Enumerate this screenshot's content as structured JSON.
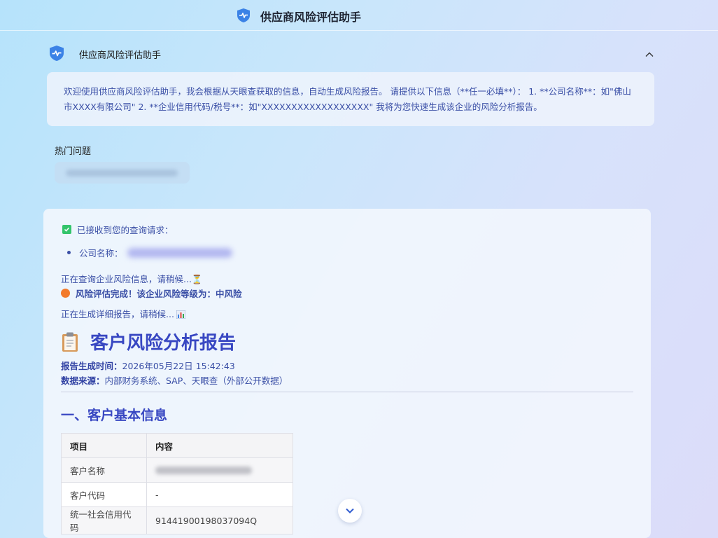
{
  "app": {
    "title": "供应商风险评估助手"
  },
  "assistant": {
    "name": "供应商风险评估助手"
  },
  "welcome": {
    "text": "欢迎使用供应商风险评估助手，我会根据从天眼查获取的信息，自动生成风险报告。 请提供以下信息（**任一必填**）： 1. **公司名称**：如\"佛山市XXXX有限公司\" 2. **企业信用代码/税号**：如\"XXXXXXXXXXXXXXXXXX\" 我将为您快速生成该企业的风险分析报告。"
  },
  "hot_questions": {
    "title": "热门问题"
  },
  "response": {
    "ack": "已接收到您的查询请求：",
    "company_label": "公司名称：",
    "status_querying": "正在查询企业风险信息，请稍候...",
    "status_done": "风险评估完成！该企业风险等级为：中风险",
    "status_generating": "正在生成详细报告，请稍候...",
    "report_title": "客户风险分析报告",
    "generated_label": "报告生成时间：",
    "generated_value": "2026年05月22日 15:42:43",
    "source_label": "数据来源：",
    "source_value": "内部财务系统、SAP、天眼查（外部公开数据）",
    "section1_title": "一、客户基本信息",
    "table": {
      "headers": [
        "项目",
        "内容"
      ],
      "rows": [
        {
          "item": "客户名称"
        },
        {
          "item": "客户代码",
          "value": "-"
        },
        {
          "item": "统一社会信用代码",
          "value": "91441900198037094Q"
        }
      ]
    }
  },
  "colors": {
    "accent": "#3847c2",
    "text_blue": "#3a4fa6",
    "success": "#33c46b",
    "warning": "#f27a2a",
    "logo": "#3b82e6"
  }
}
